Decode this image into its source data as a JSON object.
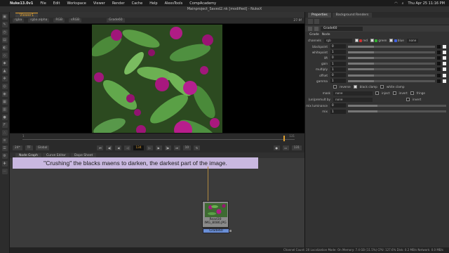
{
  "menubar": {
    "app": "Nuke13.0v1",
    "items": [
      "File",
      "Edit",
      "Workspace",
      "Viewer",
      "Render",
      "Cache",
      "Help",
      "AlexsTools",
      "CompAcademy"
    ],
    "clock": "Thu Apr 25  11:16 PM"
  },
  "window": {
    "title": "Mainproject_Saved2.nk [modified] - NukeX"
  },
  "viewer": {
    "tab": "Viewer1",
    "channels": "rgba",
    "alpha": "rgba.alpha",
    "colorspace_mode": "RGB",
    "colorspace": "sRGB",
    "node": "Grade60",
    "zoom": "27.9f",
    "info_left": "4032x3024  bbox: 0 0 4032 3024 channels: rgb",
    "info_xy": "x=239 y=1098 19x13",
    "info_r": "0.23808",
    "info_g": "0.65333",
    "info_b": "0.00749",
    "info_a": "0.00000",
    "info_hsv": "H:129 S:0.61 V:0.40  L: 0.3329"
  },
  "timeline": {
    "ticks": [
      "1",
      "",
      "",
      "",
      "",
      "",
      "",
      "",
      "",
      "",
      "",
      "",
      "",
      "",
      "131"
    ],
    "fps": "24*",
    "tf": "TF",
    "global": "Global",
    "frame": "134",
    "step": "10",
    "end": "131"
  },
  "nodegraph": {
    "tabs": [
      "Node Graph",
      "Curve Editor",
      "Dope Sheet"
    ],
    "annotation": "\"Crushing\" the blacks maens to darken, the darkest part of the image.",
    "read_label": "Read30",
    "read_file": "IMG_8086.JPG",
    "grade_label": "Grade60"
  },
  "properties": {
    "tabs": [
      "Properties",
      "Background Renders"
    ],
    "node_name": "Grade60",
    "subtabs": [
      "Grade",
      "Node"
    ],
    "channels_label": "channels",
    "channels_value": "rgb",
    "ch_red": "red",
    "ch_green": "green",
    "ch_blue": "blue",
    "ch_none": "none",
    "rows": [
      {
        "label": "blackpoint",
        "value": "0"
      },
      {
        "label": "whitepoint",
        "value": "1"
      },
      {
        "label": "lift",
        "value": "0"
      },
      {
        "label": "gain",
        "value": "1"
      },
      {
        "label": "multiply",
        "value": "1"
      },
      {
        "label": "offset",
        "value": "0"
      },
      {
        "label": "gamma",
        "value": "1"
      }
    ],
    "reverse": "reverse",
    "black_clamp": "black clamp",
    "white_clamp": "white clamp",
    "mask_label": "mask",
    "mask_value": "none",
    "inject": "inject",
    "invert": "invert",
    "fringe": "fringe",
    "unpremult_label": "(un)premult by",
    "unpremult_value": "none",
    "invert2": "invert",
    "mixlum_label": "mix luminance",
    "mixlum_value": "0",
    "mix_label": "mix",
    "mix_value": "1"
  },
  "statusbar": "Channel Count: 20  Localization Mode: On  Memory: 7.4 GB (11.5%)  CPU: 127.6%  Disk: 0.2 MB/s  Network: 0.0 MB/s"
}
